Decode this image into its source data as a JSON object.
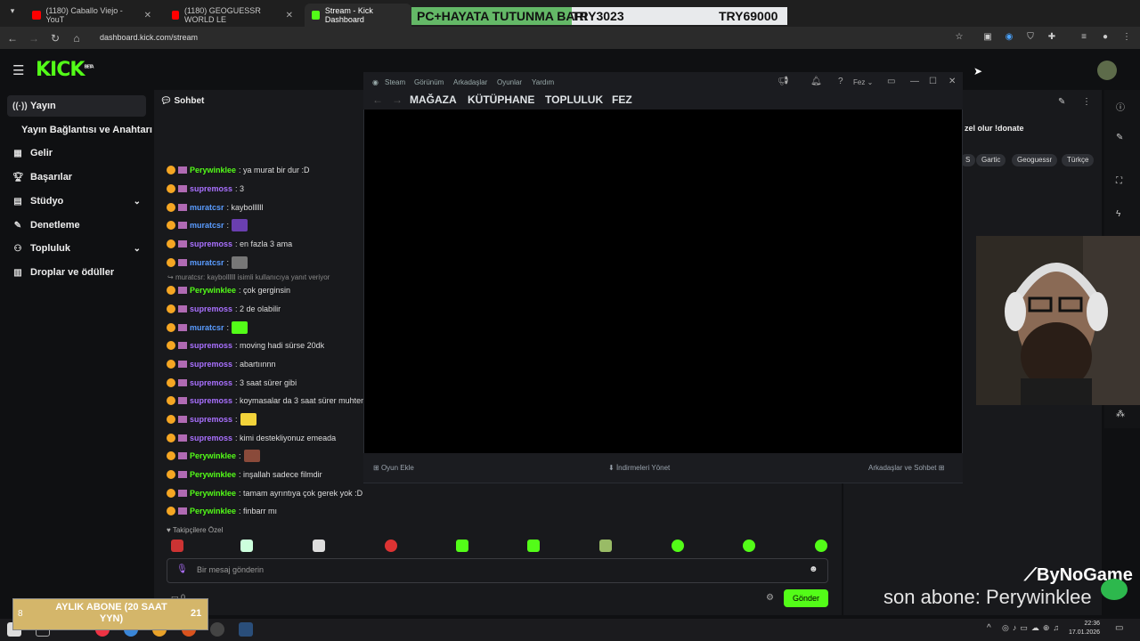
{
  "browser": {
    "tabs": [
      {
        "label": "(1180) Caballo Viejo - YouT",
        "favicon_color": "#ff0000"
      },
      {
        "label": "(1180) GEOGUESSR WORLD LE",
        "favicon_color": "#ff0000"
      },
      {
        "label": "Stream - Kick Dashboard",
        "favicon_color": "#53fc18"
      }
    ],
    "url": "dashboard.kick.com/stream"
  },
  "banner": {
    "left": "PC+HAYATA TUTUNMA BARI",
    "mid": "TRY3023",
    "right": "TRY69000"
  },
  "kick": {
    "logo": "KICK",
    "logo_sup": "BETA"
  },
  "sidebar": {
    "items": [
      {
        "label": "Yayın",
        "icon": "broadcast-icon"
      },
      {
        "label": "Yayın Bağlantısı ve Anahtarı",
        "icon": ""
      },
      {
        "label": "Gelir",
        "icon": "revenue-icon"
      },
      {
        "label": "Başarılar",
        "icon": "trophy-icon"
      },
      {
        "label": "Stüdyo",
        "icon": "studio-icon"
      },
      {
        "label": "Denetleme",
        "icon": "wrench-icon"
      },
      {
        "label": "Topluluk",
        "icon": "community-icon"
      },
      {
        "label": "Droplar ve ödüller",
        "icon": "drops-icon"
      }
    ]
  },
  "chat": {
    "title": "Sohbet",
    "messages": [
      {
        "user": "Perywinklee",
        "text": ": ya murat bir dur :D",
        "color": "#53fc18"
      },
      {
        "user": "supremoss",
        "text": ": 3",
        "color": "#a970ff"
      },
      {
        "user": "muratcsr",
        "text": ": kaybollllll",
        "color": "#5a9cff"
      },
      {
        "user": "muratcsr",
        "text": ":",
        "color": "#5a9cff",
        "emote": "#6a3fb0"
      },
      {
        "user": "supremoss",
        "text": ": en fazla 3 ama",
        "color": "#a970ff"
      },
      {
        "user": "muratcsr",
        "text": ":",
        "color": "#5a9cff",
        "emote": "#777"
      },
      {
        "user": "Perywinklee",
        "text": ": çok gerginsin",
        "color": "#53fc18"
      },
      {
        "user": "supremoss",
        "text": ": 2 de olabilir",
        "color": "#a970ff"
      },
      {
        "user": "muratcsr",
        "text": ":",
        "color": "#5a9cff",
        "emote": "#53fc18"
      },
      {
        "user": "supremoss",
        "text": ": moving hadi sürse 20dk",
        "color": "#a970ff"
      },
      {
        "user": "supremoss",
        "text": ": abartıınnn",
        "color": "#a970ff"
      },
      {
        "user": "supremoss",
        "text": ": 3 saat sürer gibi",
        "color": "#a970ff"
      },
      {
        "user": "supremoss",
        "text": ": koymasalar da 3 saat sürer muhtem",
        "color": "#a970ff"
      },
      {
        "user": "supremoss",
        "text": ":",
        "color": "#a970ff",
        "emote": "#f2d33a"
      },
      {
        "user": "supremoss",
        "text": ": kimi destekliyonuz emeada",
        "color": "#a970ff"
      },
      {
        "user": "Perywinklee",
        "text": ":",
        "color": "#53fc18",
        "emote": "#8a4a3a"
      },
      {
        "user": "Perywinklee",
        "text": ": inşallah sadece filmdir",
        "color": "#53fc18"
      },
      {
        "user": "Perywinklee",
        "text": ": tamam ayrıntıya çok gerek yok :D",
        "color": "#53fc18"
      },
      {
        "user": "Perywinklee",
        "text": ": finbarr mı",
        "color": "#53fc18"
      }
    ],
    "reply_note": "muratcsr: kaybollllll isimli kullanıcıya yanıt veriyor",
    "followers_label": "Takipçilere Özel",
    "input_placeholder": "Bir mesaj gönderin",
    "send_label": "Gönder",
    "input_count": "0"
  },
  "right_panel": {
    "donate_text": "zel olur !donate",
    "tags": [
      "S",
      "Gartic",
      "Geoguessr",
      "Türkçe"
    ],
    "overlay_last_sub": "son abone: Perywinklee",
    "overlay_brand": "ByNoGame"
  },
  "steam": {
    "menu": [
      "Steam",
      "Görünüm",
      "Arkadaşlar",
      "Oyunlar",
      "Yardım"
    ],
    "user": "Fez",
    "nav": [
      "MAĞAZA",
      "KÜTÜPHANE",
      "TOPLULUK",
      "FEZ"
    ],
    "footer": {
      "add_game": "Oyun Ekle",
      "downloads": "İndirmeleri Yönet",
      "friends": "Arkadaşlar ve Sohbet"
    }
  },
  "sub_goal": {
    "left_num": "8",
    "text": "AYLIK ABONE (20 SAAT YYN)",
    "right_num": "21"
  },
  "taskbar": {
    "time": "22:36",
    "date": "17.01.2026"
  }
}
